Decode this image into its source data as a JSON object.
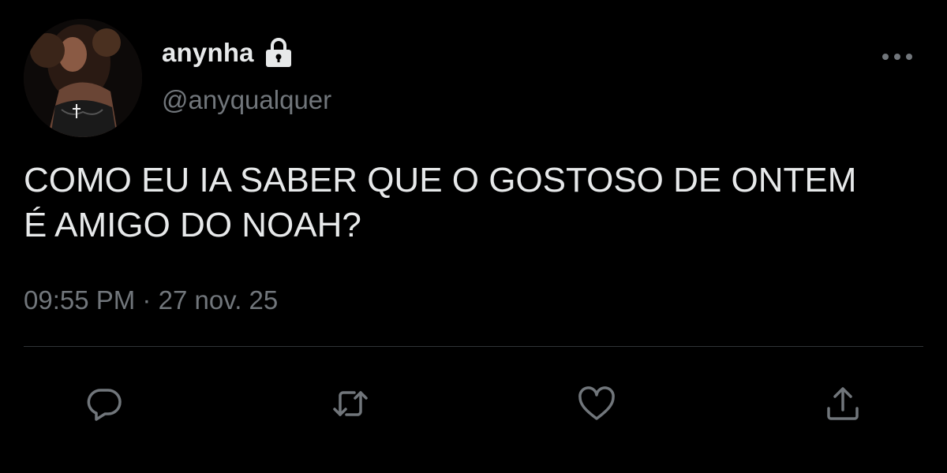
{
  "tweet": {
    "display_name": "anynha",
    "handle": "@anyqualquer",
    "text": "COMO EU IA SABER QUE O GOSTOSO DE ONTEM\nÉ AMIGO DO NOAH?",
    "time": "09:55 PM",
    "separator": "·",
    "date": "27 nov. 25",
    "icons": {
      "lock": "lock-icon",
      "more": "more-icon",
      "reply": "reply-icon",
      "retweet": "retweet-icon",
      "like": "heart-icon",
      "share": "share-icon"
    }
  },
  "colors": {
    "background": "#000000",
    "text_primary": "#e7e9ea",
    "text_secondary": "#71767b",
    "divider": "#2f3336"
  }
}
